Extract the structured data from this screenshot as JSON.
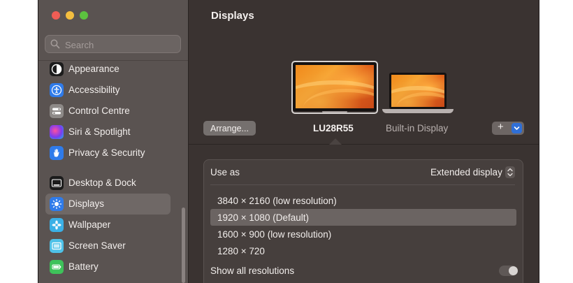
{
  "sidebar": {
    "search_placeholder": "Search",
    "items": [
      {
        "label": "Appearance",
        "icon": "appearance-icon"
      },
      {
        "label": "Accessibility",
        "icon": "accessibility-icon"
      },
      {
        "label": "Control Centre",
        "icon": "control-centre-icon"
      },
      {
        "label": "Siri & Spotlight",
        "icon": "siri-icon"
      },
      {
        "label": "Privacy & Security",
        "icon": "privacy-hand-icon"
      },
      {
        "label": "Desktop & Dock",
        "icon": "desktop-dock-icon"
      },
      {
        "label": "Displays",
        "icon": "displays-sun-icon",
        "selected": true
      },
      {
        "label": "Wallpaper",
        "icon": "wallpaper-flower-icon"
      },
      {
        "label": "Screen Saver",
        "icon": "screen-saver-icon"
      },
      {
        "label": "Battery",
        "icon": "battery-icon"
      }
    ]
  },
  "main": {
    "title": "Displays",
    "arrange_label": "Arrange...",
    "displays": [
      {
        "name": "LU28R55",
        "selected": true
      },
      {
        "name": "Built-in Display",
        "selected": false
      }
    ],
    "add_label": "+",
    "use_as": {
      "label": "Use as",
      "value": "Extended display"
    },
    "resolutions": [
      {
        "label": "3840 × 2160 (low resolution)",
        "selected": false
      },
      {
        "label": "1920 × 1080 (Default)",
        "selected": true
      },
      {
        "label": "1600 × 900 (low resolution)",
        "selected": false
      },
      {
        "label": "1280 × 720",
        "selected": false
      }
    ],
    "show_all": {
      "label": "Show all resolutions",
      "enabled": false
    }
  },
  "colors": {
    "sidebar_bg": "#5a5351",
    "main_bg": "#3a3331",
    "accent_blue": "#2f6fd6",
    "selection": "#6b6462"
  }
}
